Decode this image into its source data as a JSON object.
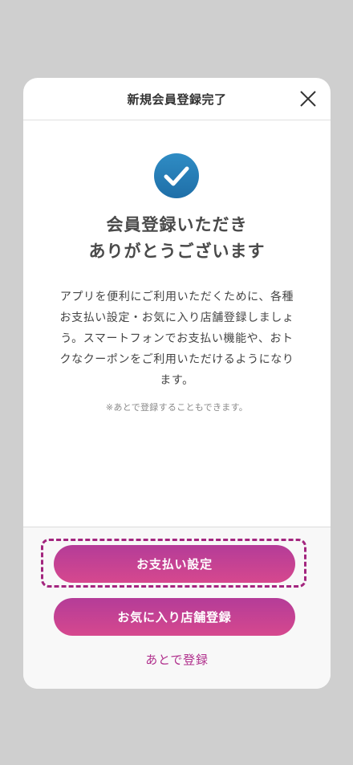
{
  "modal": {
    "title": "新規会員登録完了",
    "close_icon": "close-icon",
    "check_icon": "check-circle-icon",
    "check_color": "#2a7fb6",
    "heading_line1": "会員登録いただき",
    "heading_line2": "ありがとうございます",
    "description_lines": [
      "アプリを便利にご利用いただくために、各種",
      "お支払い設定・お気に入り店舗登録しましょ",
      "う。スマートフォンでお支払い機能や、おト",
      "クなクーポンをご利用いただけるようになり",
      "ます。"
    ],
    "note": "※あとで登録することもできます。"
  },
  "footer": {
    "payment_button": "お支払い設定",
    "favorite_button": "お気に入り店舗登録",
    "later_link": "あとで登録"
  },
  "colors": {
    "accent": "#b43c98",
    "highlight": "#a3257e",
    "link": "#b02f8c"
  }
}
